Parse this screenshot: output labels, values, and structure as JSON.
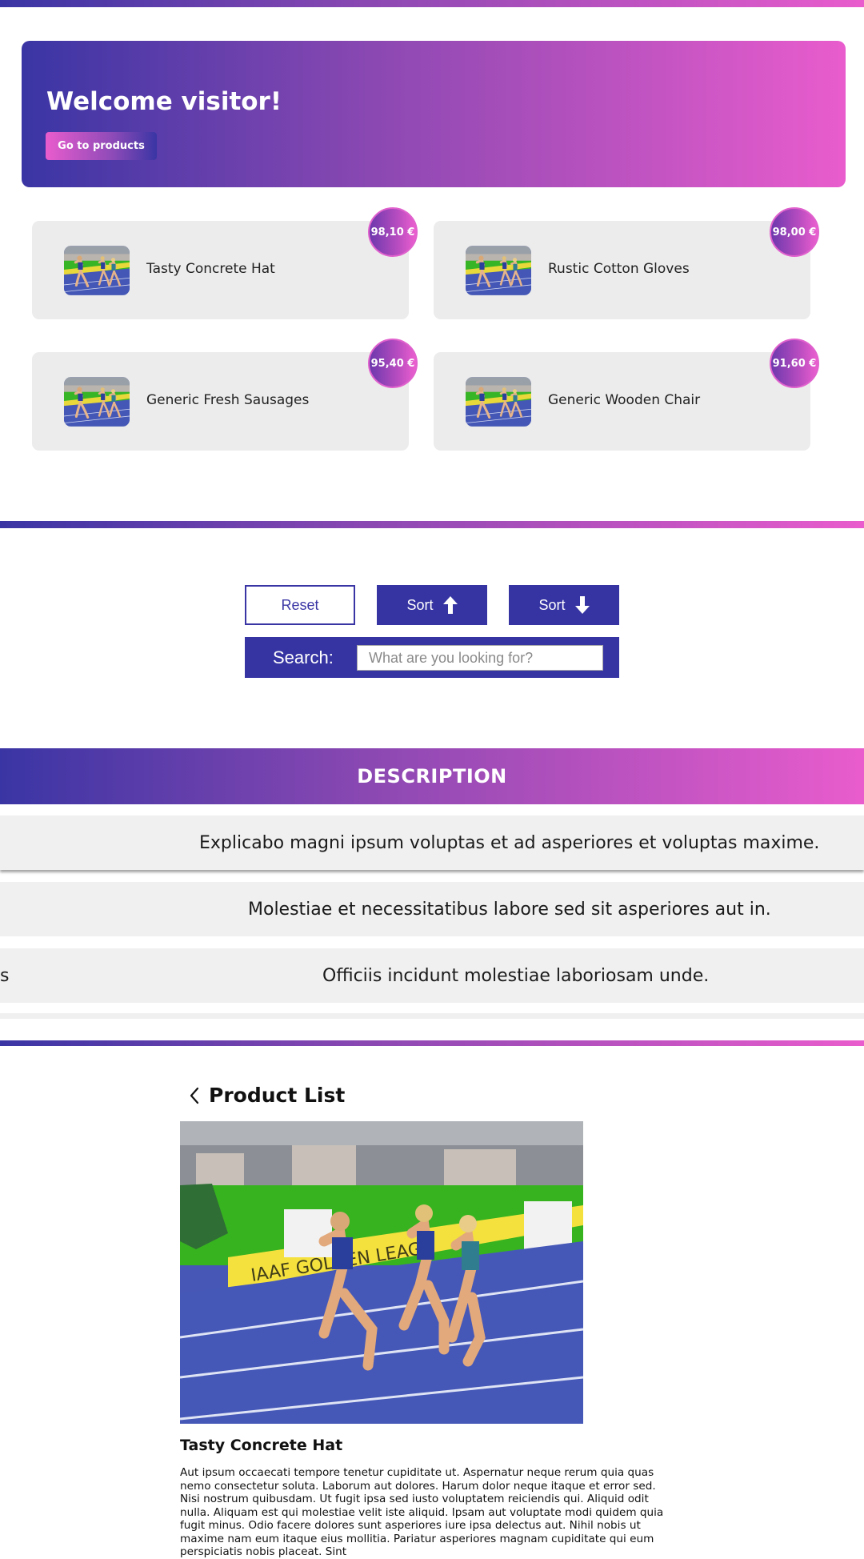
{
  "hero": {
    "title": "Welcome visitor!",
    "button_label": "Go to products"
  },
  "products": [
    {
      "name": "Tasty Concrete Hat",
      "price": "98,10 €"
    },
    {
      "name": "Rustic Cotton Gloves",
      "price": "98,00 €"
    },
    {
      "name": "Generic Fresh Sausages",
      "price": "95,40 €"
    },
    {
      "name": "Generic Wooden Chair",
      "price": "91,60 €"
    }
  ],
  "controls": {
    "reset_label": "Reset",
    "sort_up_label": "Sort",
    "sort_down_label": "Sort",
    "search_label": "Search:",
    "search_placeholder": "What are you looking for?",
    "search_value": ""
  },
  "description": {
    "heading": "DESCRIPTION",
    "rows": [
      "Explicabo magni ipsum voluptas et ad asperiores et voluptas maxime.",
      "Molestiae et necessitatibus labore sed sit asperiores aut in.",
      "Officiis incidunt molestiae laboriosam unde."
    ],
    "overflow_fragment": "s"
  },
  "detail": {
    "back_title": "Product List",
    "product_name": "Tasty Concrete Hat",
    "body": "Aut ipsum occaecati tempore tenetur cupiditate ut. Aspernatur neque rerum quia quas nemo consectetur soluta. Laborum aut dolores. Harum dolor neque itaque et error sed. Nisi nostrum quibusdam. Ut fugit ipsa sed iusto voluptatem reiciendis qui. Aliquid odit nulla. Aliquam est qui molestiae velit iste aliquid. Ipsam aut voluptate modi quidem quia fugit minus. Odio facere dolores sunt asperiores iure ipsa delectus aut. Nihil nobis ut maxime nam eum itaque eius mollitia. Pariatur asperiores magnam cupiditate qui eum perspiciatis nobis placeat. Sint"
  },
  "colors": {
    "brand_dark": "#3634a3",
    "brand_pink": "#e95ccd",
    "card_bg": "#ececec"
  }
}
